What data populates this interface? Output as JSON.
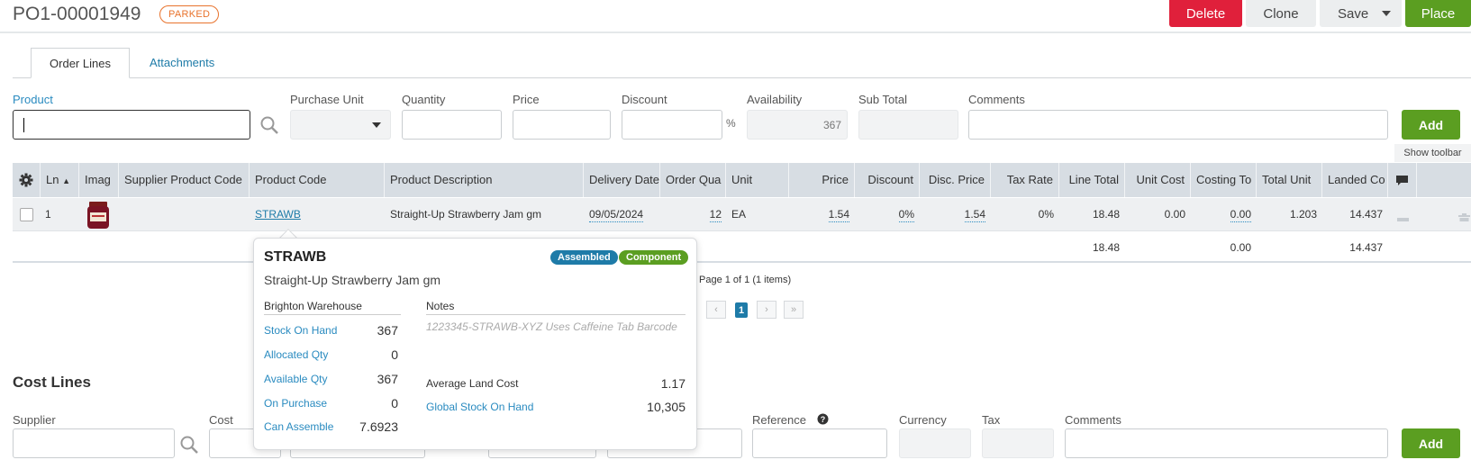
{
  "header": {
    "po_number": "PO1-00001949",
    "status": "PARKED",
    "buttons": {
      "delete": "Delete",
      "clone": "Clone",
      "save": "Save",
      "place": "Place"
    }
  },
  "tabs": [
    {
      "label": "Order Lines",
      "active": true
    },
    {
      "label": "Attachments",
      "active": false
    }
  ],
  "line_form": {
    "product_label": "Product",
    "purchase_unit_label": "Purchase Unit",
    "quantity_label": "Quantity",
    "price_label": "Price",
    "discount_label": "Discount",
    "discount_suffix": "%",
    "availability_label": "Availability",
    "availability_value": "367",
    "subtotal_label": "Sub Total",
    "comments_label": "Comments",
    "add_label": "Add",
    "show_toolbar": "Show toolbar"
  },
  "grid": {
    "columns": [
      "Ln",
      "Imag",
      "Supplier Product Code",
      "Product Code",
      "Product Description",
      "Delivery Date",
      "Order Qua",
      "Unit",
      "Price",
      "Discount",
      "Disc. Price",
      "Tax Rate",
      "Line Total",
      "Unit Cost",
      "Costing To",
      "Total Unit",
      "Landed Co"
    ],
    "rows": [
      {
        "ln": "1",
        "supplier_code": "",
        "product_code": "STRAWB",
        "description": "Straight-Up Strawberry Jam gm",
        "delivery_date": "09/05/2024",
        "order_qty": "12",
        "unit": "EA",
        "price": "1.54",
        "discount": "0%",
        "disc_price": "1.54",
        "tax_rate": "0%",
        "line_total": "18.48",
        "unit_cost": "0.00",
        "costing_total": "0.00",
        "total_unit": "1.203",
        "landed_cost": "14.437"
      }
    ],
    "totals": {
      "line_total": "18.48",
      "costing_total": "0.00",
      "landed_cost": "14.437"
    }
  },
  "pager": {
    "text": "Page 1 of 1 (1 items)",
    "current": "1"
  },
  "cost_lines": {
    "title": "Cost Lines",
    "supplier_label": "Supplier",
    "cost_label": "Cost",
    "reference_label": "Reference",
    "currency_label": "Currency",
    "tax_label": "Tax",
    "comments_label": "Comments",
    "add_label": "Add"
  },
  "popover": {
    "code": "STRAWB",
    "description": "Straight-Up Strawberry Jam gm",
    "badges": [
      "Assembled",
      "Component"
    ],
    "warehouse": "Brighton Warehouse",
    "stats": [
      {
        "label": "Stock On Hand",
        "value": "367"
      },
      {
        "label": "Allocated Qty",
        "value": "0"
      },
      {
        "label": "Available Qty",
        "value": "367"
      },
      {
        "label": "On Purchase",
        "value": "0"
      },
      {
        "label": "Can Assemble",
        "value": "7.6923"
      }
    ],
    "notes_label": "Notes",
    "notes": "1223345-STRAWB-XYZ Uses Caffeine Tab Barcode",
    "avg_land_cost_label": "Average Land Cost",
    "avg_land_cost": "1.17",
    "global_stock_label": "Global Stock On Hand",
    "global_stock": "10,305"
  },
  "colors": {
    "delete": "#e0203b",
    "place": "#5b9e21",
    "link": "#2a8bc0",
    "parked": "#e8732d",
    "grid_header": "#d7dde3"
  }
}
